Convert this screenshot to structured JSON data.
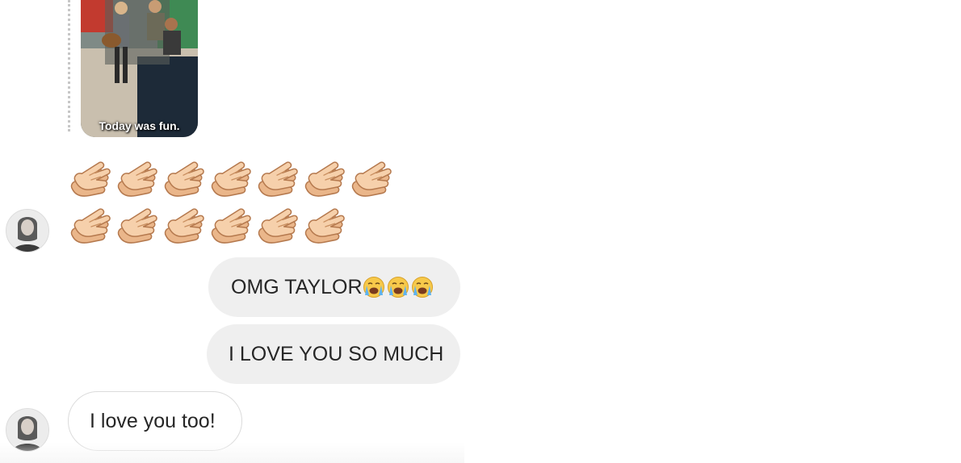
{
  "story": {
    "caption": "Today was fun."
  },
  "reactions": {
    "emoji": "clapping-hands",
    "rows": [
      7,
      6
    ]
  },
  "messages": [
    {
      "sender": "me",
      "text": "OMG TAYLOR",
      "emoji_suffix": [
        "sob",
        "sob",
        "sob"
      ]
    },
    {
      "sender": "me",
      "text": "I LOVE YOU SO MUCH"
    },
    {
      "sender": "them",
      "text": "I love you too!"
    }
  ],
  "colors": {
    "sent_bubble": "#efefef",
    "received_border": "#dbdbdb",
    "text": "#262626",
    "clap_skin": "#f2c49b"
  }
}
